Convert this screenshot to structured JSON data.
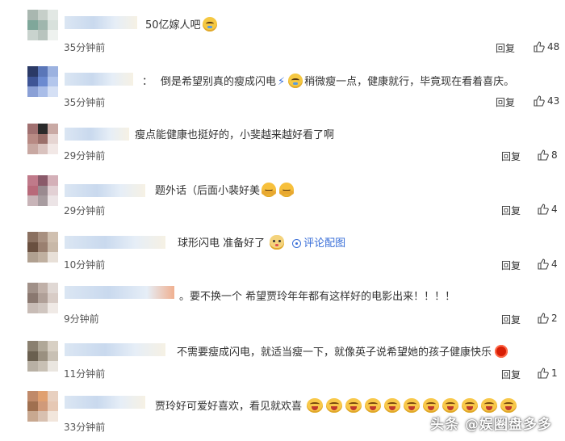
{
  "comments": [
    {
      "text": "50亿嫁人吧",
      "time": "35分钟前",
      "reply": "回复",
      "likes": "48",
      "emoji_after": "cry-emoji"
    },
    {
      "text_a": "倒是希望别真的瘦成闪电",
      "text_b": "稍微瘦一点，健康就行，毕竟现在看着喜庆。",
      "prefix": "：",
      "time": "35分钟前",
      "reply": "回复",
      "likes": "43"
    },
    {
      "text": "瘦点能健康也挺好的，小斐越来越好看了啊",
      "time": "29分钟前",
      "reply": "回复",
      "likes": "8"
    },
    {
      "text": "题外话（后面小裴好美",
      "time": "29分钟前",
      "reply": "回复",
      "likes": "4"
    },
    {
      "text": "球形闪电 准备好了",
      "link": "评论配图",
      "time": "10分钟前",
      "reply": "回复",
      "likes": "4"
    },
    {
      "text": "。要不换一个 希望贾玲年年都有这样好的电影出来！！！！",
      "time": "9分钟前",
      "reply": "回复",
      "likes": "2"
    },
    {
      "text": "不需要瘦成闪电，就适当瘦一下，就像英子说希望她的孩子健康快乐",
      "time": "11分钟前",
      "reply": "回复",
      "likes": "1"
    },
    {
      "text": "贾玲好可爱好喜欢，看见就欢喜",
      "time": "33分钟前",
      "reply": "回复",
      "likes": ""
    }
  ],
  "watermark": "头条 @娱圈盘多多"
}
